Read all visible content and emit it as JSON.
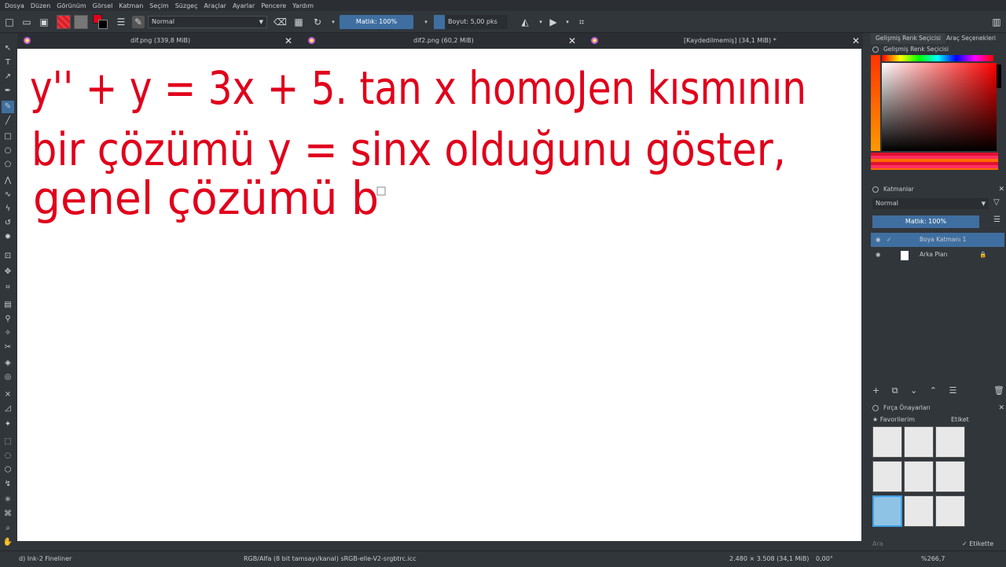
{
  "menu": [
    "Dosya",
    "Düzen",
    "Görünüm",
    "Görsel",
    "Katman",
    "Seçim",
    "Süzgeç",
    "Araçlar",
    "Ayarlar",
    "Pencere",
    "Yardım"
  ],
  "toolbar": {
    "blend_mode": "Normal",
    "opacity": "Matlık: 100%",
    "size": "Boyut: 5,00 pks"
  },
  "tabs": [
    {
      "title": "dif.png (339,8 MiB)"
    },
    {
      "title": "dif2.png (60,2 MiB)"
    },
    {
      "title": "[Kaydedilmemiş]  (34,1 MiB) *"
    }
  ],
  "canvas": {
    "line1": "y'' + y = 3x + 5. tan x   homoJen kısmının",
    "line2": "bir çözümü  y = sinx  olduğunu  göster,",
    "line3": "genel çözümü b"
  },
  "right_panel": {
    "tab1": "Gelişmiş Renk Seçicisi",
    "tab2": "Araç Seçenekleri",
    "color_title": "Gelişmiş Renk Seçicisi",
    "layers_title": "Katmanlar",
    "layer_blend": "Normal",
    "layer_opacity": "Matlık:  100%",
    "layers": [
      {
        "name": "Boya Katmanı 1"
      },
      {
        "name": "Arka Plan"
      }
    ],
    "brush_title": "Fırça Önayarları",
    "brush_tag": "Favorilerim",
    "brush_label": "Etiket",
    "search_placeholder": "Ara",
    "filter_label": "Etikette süz"
  },
  "status": {
    "brush": "d) Ink-2 Fineliner",
    "color": "RGB/Alfa (8 bit tamsayı/kanal)  sRGB-elle-V2-srgbtrc.icc",
    "size": "2.480 × 3.508 (34,1 MiB)",
    "rotation": "0,00°",
    "zoom": "%266,7"
  },
  "colors": {
    "ink": "#e0001b",
    "accent": "#3f6fa0"
  }
}
